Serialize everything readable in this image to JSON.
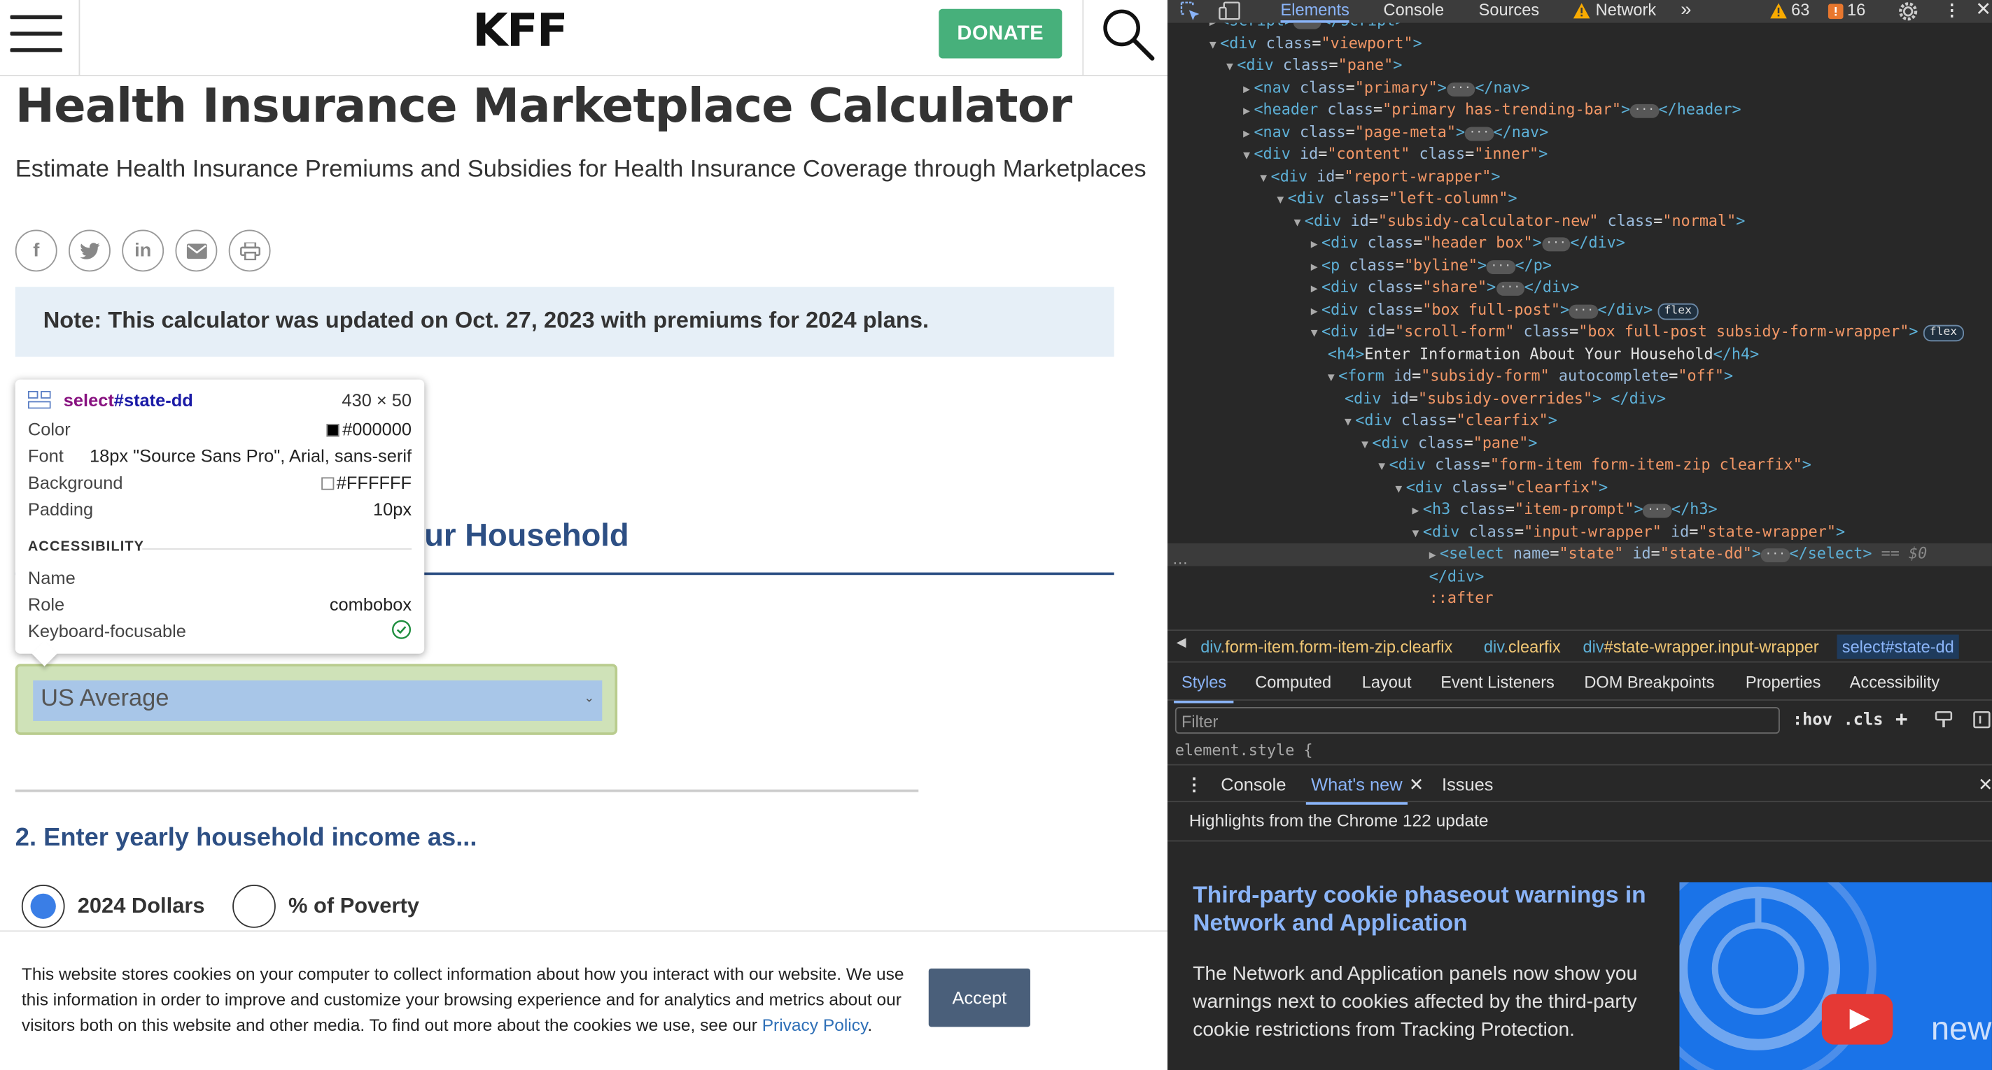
{
  "page": {
    "logo": "KFF",
    "donate_label": "DONATE",
    "title": "Health Insurance Marketplace Calculator",
    "subtitle": "Estimate Health Insurance Premiums and Subsidies for Health Insurance Coverage through Marketplaces",
    "share_icons": [
      "facebook-icon",
      "twitter-icon",
      "linkedin-icon",
      "email-icon",
      "print-icon"
    ],
    "note": "Note: This calculator was updated on Oct. 27, 2023 with premiums for 2024 plans.",
    "section_title_visible": "ur Household",
    "state_select_value": "US Average",
    "question2": "2. Enter yearly household income as...",
    "radio_options": [
      {
        "label": "2024 Dollars",
        "selected": true
      },
      {
        "label": "% of Poverty",
        "selected": false
      }
    ],
    "cookie_text": "This website stores cookies on your computer to collect information about how you interact with our website. We use this information in order to improve and customize your browsing experience and for analytics and metrics about our visitors both on this website and other media. To find out more about the cookies we use, see our ",
    "cookie_link": "Privacy Policy",
    "cookie_end": ".",
    "accept_label": "Accept",
    "accent_color": "#2d4f84",
    "donate_color": "#47b07b"
  },
  "tooltip": {
    "tag": "select",
    "id": "#state-dd",
    "dims": "430 × 50",
    "rows": [
      {
        "k": "Color",
        "v": "#000000"
      },
      {
        "k": "Font",
        "v": "18px \"Source Sans Pro\", Arial, sans-serif"
      },
      {
        "k": "Background",
        "v": "#FFFFFF"
      },
      {
        "k": "Padding",
        "v": "10px"
      }
    ],
    "accessibility_heading": "ACCESSIBILITY",
    "acc_rows": [
      {
        "k": "Name",
        "v": ""
      },
      {
        "k": "Role",
        "v": "combobox"
      },
      {
        "k": "Keyboard-focusable",
        "v": "✓"
      }
    ]
  },
  "devtools": {
    "tabs": [
      "Elements",
      "Console",
      "Sources",
      "Network"
    ],
    "more": "»",
    "warnings": "63",
    "errors": "16",
    "code_lines": [
      {
        "indent": 0,
        "html": "<span class='tri'>▶</span><span class='t'>&lt;script&gt;</span><span class='ell'>···</span><span class='t'>&lt;/script&gt;</span>"
      },
      {
        "indent": 0,
        "html": "<span class='tri'>▼</span><span class='t'>&lt;div</span> <span class='a'>class</span>=<span class='s'>\"viewport\"</span><span class='t'>&gt;</span>"
      },
      {
        "indent": 1,
        "html": "<span class='tri'>▼</span><span class='t'>&lt;div</span> <span class='a'>class</span>=<span class='s'>\"pane\"</span><span class='t'>&gt;</span>"
      },
      {
        "indent": 2,
        "html": "<span class='tri'>▶</span><span class='t'>&lt;nav</span> <span class='a'>class</span>=<span class='s'>\"primary\"</span><span class='t'>&gt;</span><span class='ell'>···</span><span class='t'>&lt;/nav&gt;</span>"
      },
      {
        "indent": 2,
        "html": "<span class='tri'>▶</span><span class='t'>&lt;header</span> <span class='a'>class</span>=<span class='s'>\"primary has-trending-bar\"</span><span class='t'>&gt;</span><span class='ell'>···</span><span class='t'>&lt;/header&gt;</span>"
      },
      {
        "indent": 2,
        "html": "<span class='tri'>▶</span><span class='t'>&lt;nav</span> <span class='a'>class</span>=<span class='s'>\"page-meta\"</span><span class='t'>&gt;</span><span class='ell'>···</span><span class='t'>&lt;/nav&gt;</span>"
      },
      {
        "indent": 2,
        "html": "<span class='tri'>▼</span><span class='t'>&lt;div</span> <span class='a'>id</span>=<span class='s'>\"content\"</span> <span class='a'>class</span>=<span class='s'>\"inner\"</span><span class='t'>&gt;</span>"
      },
      {
        "indent": 3,
        "html": "<span class='tri'>▼</span><span class='t'>&lt;div</span> <span class='a'>id</span>=<span class='s'>\"report-wrapper\"</span><span class='t'>&gt;</span>"
      },
      {
        "indent": 4,
        "html": "<span class='tri'>▼</span><span class='t'>&lt;div</span> <span class='a'>class</span>=<span class='s'>\"left-column\"</span><span class='t'>&gt;</span>"
      },
      {
        "indent": 5,
        "html": "<span class='tri'>▼</span><span class='t'>&lt;div</span> <span class='a'>id</span>=<span class='s'>\"subsidy-calculator-new\"</span> <span class='a'>class</span>=<span class='s'>\"normal\"</span><span class='t'>&gt;</span>"
      },
      {
        "indent": 6,
        "html": "<span class='tri'>▶</span><span class='t'>&lt;div</span> <span class='a'>class</span>=<span class='s'>\"header box\"</span><span class='t'>&gt;</span><span class='ell'>···</span><span class='t'>&lt;/div&gt;</span>"
      },
      {
        "indent": 6,
        "html": "<span class='tri'>▶</span><span class='t'>&lt;p</span> <span class='a'>class</span>=<span class='s'>\"byline\"</span><span class='t'>&gt;</span><span class='ell'>···</span><span class='t'>&lt;/p&gt;</span>"
      },
      {
        "indent": 6,
        "html": "<span class='tri'>▶</span><span class='t'>&lt;div</span> <span class='a'>class</span>=<span class='s'>\"share\"</span><span class='t'>&gt;</span><span class='ell'>···</span><span class='t'>&lt;/div&gt;</span>"
      },
      {
        "indent": 6,
        "html": "<span class='tri'>▶</span><span class='t'>&lt;div</span> <span class='a'>class</span>=<span class='s'>\"box full-post\"</span><span class='t'>&gt;</span><span class='ell'>···</span><span class='t'>&lt;/div&gt;</span><span class='badge'>flex</span>"
      },
      {
        "indent": 6,
        "html": "<span class='tri'>▼</span><span class='t'>&lt;div</span> <span class='a'>id</span>=<span class='s'>\"scroll-form\"</span> <span class='a'>class</span>=<span class='s'>\"box full-post subsidy-form-wrapper\"</span><span class='t'>&gt;</span><span class='badge'>flex</span>"
      },
      {
        "indent": 7,
        "html": "<span class='t'>&lt;h4&gt;</span><span class='x'>Enter Information About Your Household</span><span class='t'>&lt;/h4&gt;</span>"
      },
      {
        "indent": 7,
        "html": "<span class='tri'>▼</span><span class='t'>&lt;form</span> <span class='a'>id</span>=<span class='s'>\"subsidy-form\"</span> <span class='a'>autocomplete</span>=<span class='s'>\"off\"</span><span class='t'>&gt;</span>"
      },
      {
        "indent": 8,
        "html": "<span class='t'>&lt;div</span> <span class='a'>id</span>=<span class='s'>\"subsidy-overrides\"</span><span class='t'>&gt;</span> <span class='t'>&lt;/div&gt;</span>"
      },
      {
        "indent": 8,
        "html": "<span class='tri'>▼</span><span class='t'>&lt;div</span> <span class='a'>class</span>=<span class='s'>\"clearfix\"</span><span class='t'>&gt;</span>"
      },
      {
        "indent": 9,
        "html": "<span class='tri'>▼</span><span class='t'>&lt;div</span> <span class='a'>class</span>=<span class='s'>\"pane\"</span><span class='t'>&gt;</span>"
      },
      {
        "indent": 10,
        "html": "<span class='tri'>▼</span><span class='t'>&lt;div</span> <span class='a'>class</span>=<span class='s'>\"form-item form-item-zip clearfix\"</span><span class='t'>&gt;</span>"
      },
      {
        "indent": 11,
        "html": "<span class='tri'>▼</span><span class='t'>&lt;div</span> <span class='a'>class</span>=<span class='s'>\"clearfix\"</span><span class='t'>&gt;</span>"
      },
      {
        "indent": 12,
        "html": "<span class='tri'>▶</span><span class='t'>&lt;h3</span> <span class='a'>class</span>=<span class='s'>\"item-prompt\"</span><span class='t'>&gt;</span><span class='ell'>···</span><span class='t'>&lt;/h3&gt;</span>"
      },
      {
        "indent": 12,
        "html": "<span class='tri'>▼</span><span class='t'>&lt;div</span> <span class='a'>class</span>=<span class='s'>\"input-wrapper\"</span> <span class='a'>id</span>=<span class='s'>\"state-wrapper\"</span><span class='t'>&gt;</span>"
      },
      {
        "indent": 13,
        "hl": true,
        "html": "<span class='tri'>▶</span><span class='t'>&lt;select</span> <span class='a'>name</span>=<span class='s'>\"state\"</span> <span class='a'>id</span>=<span class='s'>\"state-dd\"</span><span class='t'>&gt;</span><span class='ell'>···</span><span class='t'>&lt;/select&gt;</span> <span class='eq'>== $0</span>"
      },
      {
        "indent": 13,
        "html": "<span class='t'>&lt;/div&gt;</span>"
      },
      {
        "indent": 13,
        "html": "<span class='s'>::after</span>"
      }
    ],
    "breadcrumbs": [
      {
        "tag": "div",
        "cls": ".form-item.form-item-zip.clearfix"
      },
      {
        "tag": "div",
        "cls": ".clearfix"
      },
      {
        "tag": "div",
        "cls": "#state-wrapper.input-wrapper"
      },
      {
        "tag": "select",
        "cls": "#state-dd"
      }
    ],
    "subtabs": [
      "Styles",
      "Computed",
      "Layout",
      "Event Listeners",
      "DOM Breakpoints",
      "Properties",
      "Accessibility"
    ],
    "filter_placeholder": "Filter",
    "hov": ":hov",
    "cls": ".cls",
    "element_style": "element.style {",
    "drawer_tabs": [
      "Console",
      "What's new",
      "Issues"
    ],
    "highlights": "Highlights from the Chrome 122 update",
    "whats_new_title": "Third-party cookie phaseout warnings in Network and Application",
    "whats_new_body": "The Network and Application panels now show you warnings next to cookies affected by the third-party cookie restrictions from Tracking Protection.",
    "promo_text": "new"
  }
}
